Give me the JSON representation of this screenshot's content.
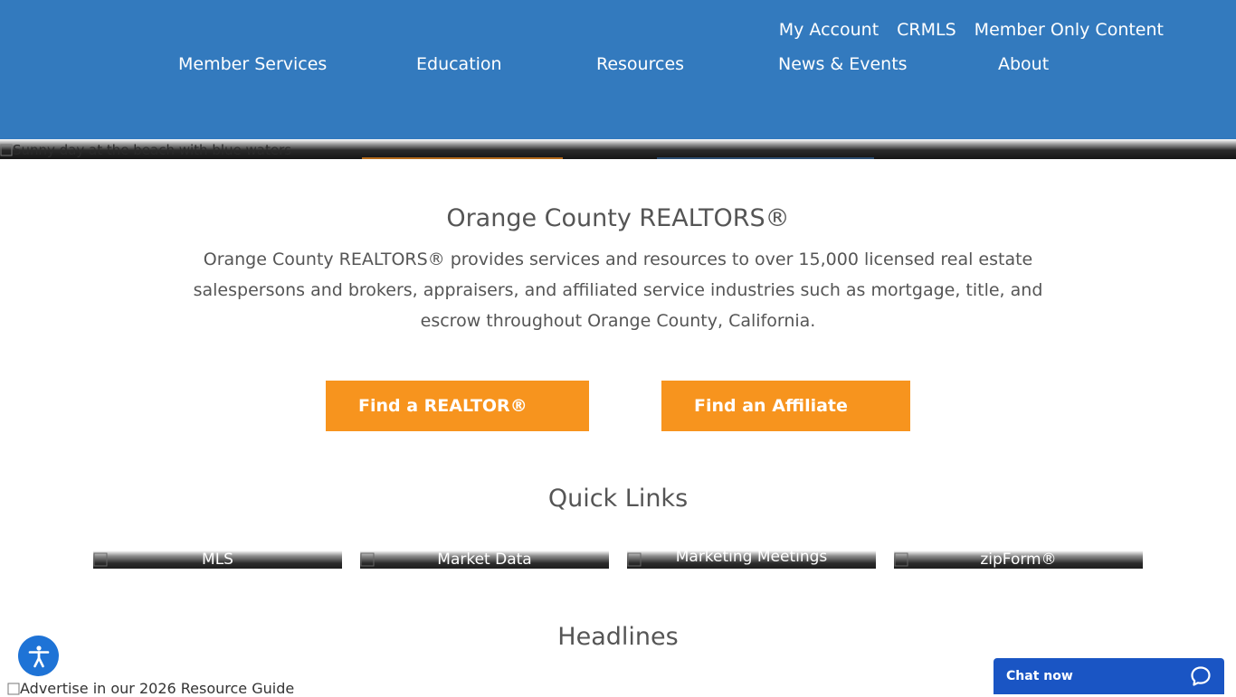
{
  "header": {
    "utility_nav": [
      "My Account",
      "CRMLS",
      "Member Only Content"
    ],
    "main_nav": [
      "Member Services",
      "Education",
      "Resources",
      "News & Events",
      "About"
    ]
  },
  "hero": {
    "alt_text": "Sunny day at the beach with blue waters"
  },
  "main": {
    "title": "Orange County REALTORS®",
    "intro": "Orange County REALTORS® provides services and resources to over 15,000 licensed real estate salespersons and brokers, appraisers, and affiliated service industries such as mortgage, title, and escrow throughout Orange County, California.",
    "cta": {
      "find_realtor": "Find a REALTOR®",
      "find_affiliate": "Find an Affiliate"
    }
  },
  "quick_links": {
    "title": "Quick Links",
    "items": [
      "MLS",
      "Market Data",
      "Marketing Meetings",
      "zipForm®"
    ]
  },
  "headlines": {
    "title": "Headlines"
  },
  "footer": {
    "advert_alt": "Advertise in our 2026 Resource Guide",
    "chat_label": "Chat now"
  },
  "colors": {
    "header_bg": "#337abe",
    "cta_bg": "#f7941e",
    "chat_bg": "#1a55c4",
    "a11y_bg": "#1e73d6"
  }
}
